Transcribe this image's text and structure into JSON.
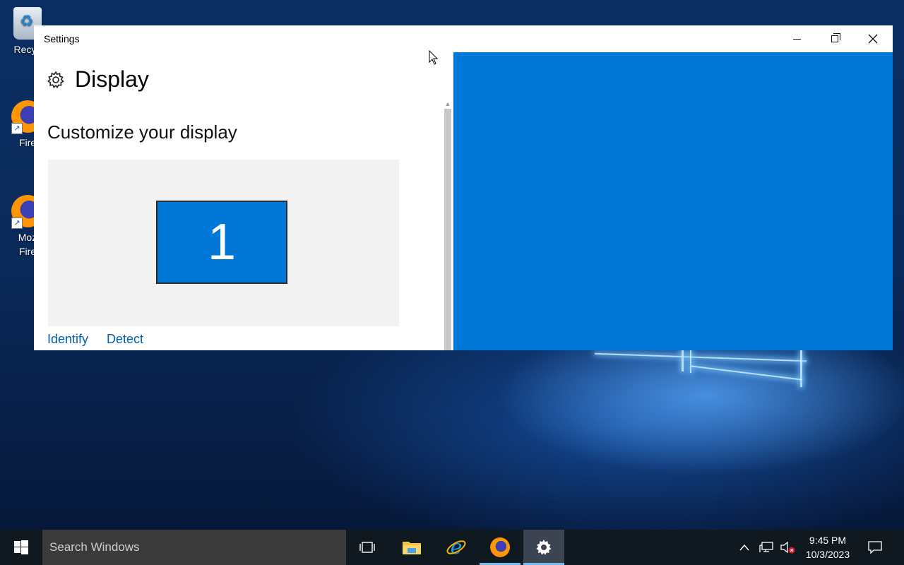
{
  "desktop": {
    "icons": [
      {
        "label": "Recyc",
        "icon": "recycle-bin-icon"
      },
      {
        "label": "Fire",
        "icon": "firefox-icon"
      },
      {
        "label_line1": "Moz",
        "label_line2": "Fire",
        "icon": "firefox-icon"
      }
    ]
  },
  "window": {
    "title": "Settings",
    "header": "Display",
    "subtitle": "Customize your display",
    "monitor_number": "1",
    "links": {
      "identify": "Identify",
      "detect": "Detect"
    },
    "accent_color": "#0078d7"
  },
  "taskbar": {
    "search_placeholder": "Search Windows",
    "apps": [
      "task-view-icon",
      "file-explorer-icon",
      "internet-explorer-icon",
      "firefox-icon",
      "settings-icon"
    ],
    "active_app": "settings-icon",
    "time": "9:45 PM",
    "date": "10/3/2023"
  }
}
